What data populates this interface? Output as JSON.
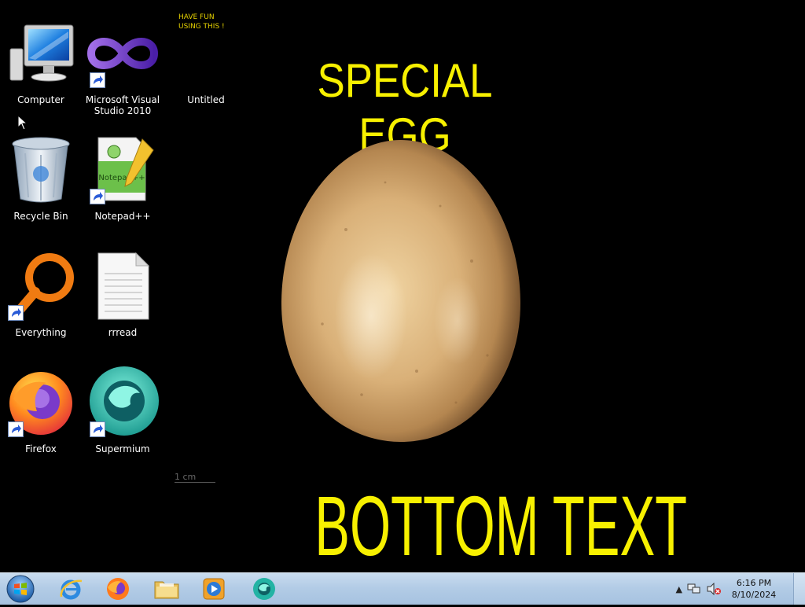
{
  "desktop": {
    "icons": [
      {
        "label": "Computer"
      },
      {
        "label": "Microsoft Visual\nStudio 2010"
      },
      {
        "label": "Untitled"
      },
      {
        "label": "Recycle Bin"
      },
      {
        "label": "Notepad++"
      },
      {
        "label": "Everything"
      },
      {
        "label": "rrread"
      },
      {
        "label": "Firefox"
      },
      {
        "label": "Supermium"
      }
    ],
    "notepad_icon_text": "Notepad++"
  },
  "wallpaper": {
    "note_line1": "HAVE FUN",
    "note_line2": "USING THIS !",
    "title": "SPECIAL EGG",
    "bottom_text": "BOTTOM TEXT",
    "scale_label": "1 cm",
    "text_color": "#f7f000"
  },
  "taskbar": {
    "apps": [
      "internet-explorer",
      "firefox",
      "windows-explorer",
      "windows-media-player",
      "supermium"
    ],
    "clock_time": "6:16 PM",
    "clock_date": "8/10/2024"
  }
}
